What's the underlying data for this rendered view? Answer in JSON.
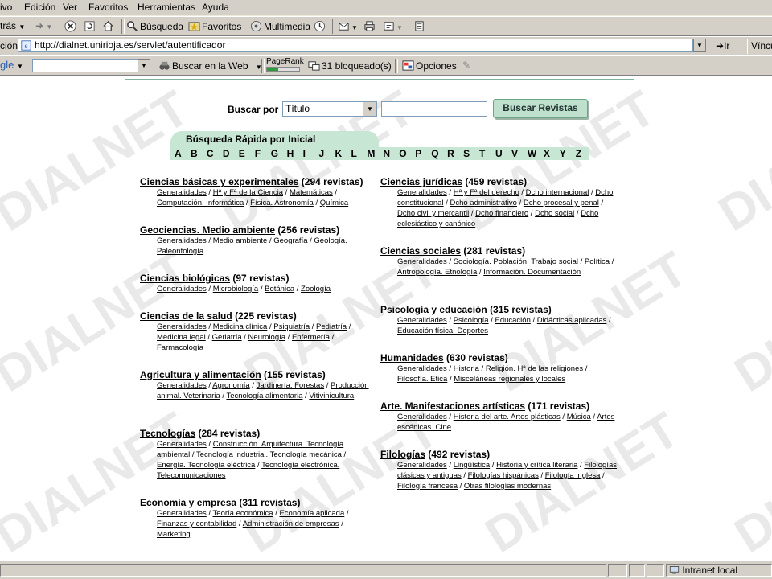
{
  "menu": [
    "ivo",
    "Edición",
    "Ver",
    "Favoritos",
    "Herramientas",
    "Ayuda"
  ],
  "toolbar": {
    "back": "trás",
    "search": "Búsqueda",
    "favorites": "Favoritos",
    "multimedia": "Multimedia"
  },
  "address": {
    "label": "ción",
    "url": "http://dialnet.unirioja.es/servlet/autentificador",
    "go": "Ir",
    "links": "Víncu"
  },
  "google": {
    "logo": "gle",
    "search_web": "Buscar en la Web",
    "pagerank": "PageRank",
    "blocked": "31 bloqueado(s)",
    "options": "Opciones"
  },
  "status": {
    "zone": "Intranet local"
  },
  "watermark": "DIALNET",
  "search": {
    "label": "Buscar por",
    "field": "Título",
    "button": "Buscar Revistas"
  },
  "quick": {
    "title": "Búsqueda Rápida por Inicial",
    "letters": [
      "A",
      "B",
      "C",
      "D",
      "E",
      "F",
      "G",
      "H",
      "I",
      "J",
      "K",
      "L",
      "M",
      "N",
      "O",
      "P",
      "Q",
      "R",
      "S",
      "T",
      "U",
      "V",
      "W",
      "X",
      "Y",
      "Z"
    ]
  },
  "left_col": [
    {
      "name": "Ciencias básicas y experimentales",
      "count": "(294 revistas)",
      "subs": [
        "Generalidades",
        "Hª y Fª de la Ciencia",
        "Matemáticas",
        "Computación. Informática",
        "Física. Astronomía",
        "Química"
      ]
    },
    {
      "name": "Geociencias. Medio ambiente",
      "count": "(256 revistas)",
      "subs": [
        "Generalidades",
        "Medio ambiente",
        "Geografía",
        "Geología. Paleontología"
      ]
    },
    {
      "name": "Ciencias biológicas",
      "count": "(97 revistas)",
      "subs": [
        "Generalidades",
        "Microbiología",
        "Botánica",
        "Zoología"
      ]
    },
    {
      "name": "Ciencias de la salud",
      "count": "(225 revistas)",
      "subs": [
        "Generalidades",
        "Medicina clínica",
        "Psiquiatría",
        "Pediatría",
        "Medicina legal",
        "Geriatría",
        "Neurología",
        "Enfermería",
        "Farmacología"
      ]
    },
    {
      "name": "Agricultura y alimentación",
      "count": "(155 revistas)",
      "subs": [
        "Generalidades",
        "Agronomía",
        "Jardinería. Forestas",
        "Producción animal. Veterinaria",
        "Tecnología alimentaria",
        "Vitivinicultura"
      ]
    },
    {
      "name": "Tecnologías",
      "count": "(284 revistas)",
      "subs": [
        "Generalidades",
        "Construcción. Arquitectura. Tecnología ambiental",
        "Tecnología industrial. Tecnología mecánica",
        "Energía. Tecnología eléctrica",
        "Tecnología electrónica. Telecomunicaciones"
      ]
    },
    {
      "name": "Economía y empresa",
      "count": "(311 revistas)",
      "subs": [
        "Generalidades",
        "Teoría económica",
        "Economía aplicada",
        "Finanzas y contabilidad",
        "Administración de empresas",
        "Marketing"
      ]
    }
  ],
  "right_col": [
    {
      "name": "Ciencias jurídicas",
      "count": "(459 revistas)",
      "subs": [
        "Generalidades",
        "Hª y Fª del derecho",
        "Dcho internacional",
        "Dcho constitucional",
        "Dcho administrativo",
        "Dcho procesal y penal",
        "Dcho civil y mercantil",
        "Dcho financiero",
        "Dcho social",
        "Dcho eclesiástico y canónico"
      ]
    },
    {
      "name": "Ciencias sociales",
      "count": "(281 revistas)",
      "subs": [
        "Generalidades",
        "Sociología. Población. Trabajo social",
        "Política",
        "Antropología. Etnología",
        "Información. Documentación"
      ]
    },
    {
      "name": "Psicología y educación",
      "count": "(315 revistas)",
      "subs": [
        "Generalidades",
        "Psicología",
        "Educación",
        "Didácticas aplicadas",
        "Educación física. Deportes"
      ]
    },
    {
      "name": "Humanidades",
      "count": "(630 revistas)",
      "subs": [
        "Generalidades",
        "Historia",
        "Religión. Hª de las religiones",
        "Filosofía. Etica",
        "Misceláneas regionales y locales"
      ]
    },
    {
      "name": "Arte. Manifestaciones artísticas",
      "count": "(171 revistas)",
      "subs": [
        "Generalidades",
        "Historia del arte. Artes plásticas",
        "Música",
        "Artes escénicas. Cine"
      ]
    },
    {
      "name": "Filologías",
      "count": "(492 revistas)",
      "subs": [
        "Generalidades",
        "Lingüística",
        "Historia y crítica literaria",
        "Filologías clásicas y antiguas",
        "Filologías hispánicas",
        "Filología inglesa",
        "Filología francesa",
        "Otras filologías modernas"
      ]
    }
  ]
}
